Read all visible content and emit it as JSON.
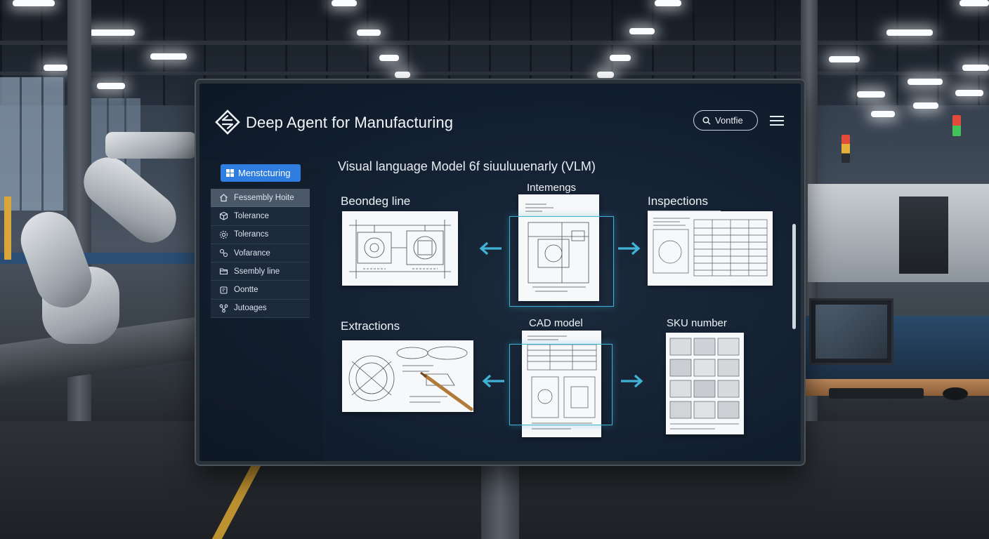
{
  "header": {
    "title": "Deep Agent for Manufacturing",
    "search_label": "Vontfie"
  },
  "sidebar": {
    "primary_button": "Menstcturing",
    "items": [
      {
        "label": "Fessembly Hoite",
        "icon": "home-icon"
      },
      {
        "label": "Tolerance",
        "icon": "box-icon"
      },
      {
        "label": "Tolerancs",
        "icon": "settings-icon"
      },
      {
        "label": "Vofarance",
        "icon": "link-icon"
      },
      {
        "label": "Ssembly line",
        "icon": "folder-icon"
      },
      {
        "label": "Oontte",
        "icon": "square-icon"
      },
      {
        "label": "Jutoages",
        "icon": "network-icon"
      }
    ]
  },
  "main": {
    "title": "Visual language Model 6f siuuluuenarly (VLM)",
    "sections": {
      "top_left": "Beondeg line",
      "top_center": "Intemengs",
      "top_right": "Inspections",
      "bottom_left": "Extractions",
      "bottom_center": "CAD model",
      "bottom_right": "SKU number"
    }
  },
  "colors": {
    "accent": "#2f7de0",
    "highlight_frame": "#3fb2d6",
    "screen_bg": "#132031"
  }
}
